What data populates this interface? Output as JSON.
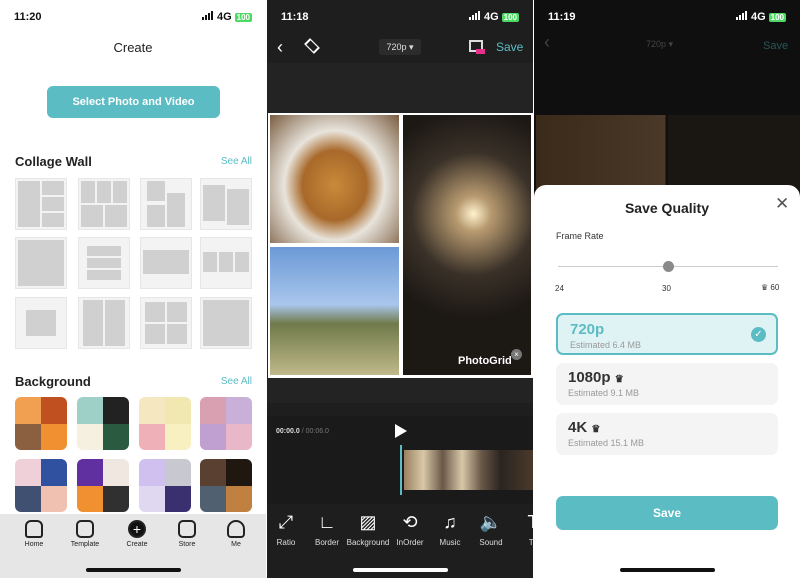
{
  "screen1": {
    "status": {
      "time": "11:20",
      "network": "4G",
      "battery": "100"
    },
    "title": "Create",
    "select_button": "Select Photo and Video",
    "collage": {
      "title": "Collage Wall",
      "see_all": "See All"
    },
    "background": {
      "title": "Background",
      "see_all": "See All"
    },
    "tabs": [
      {
        "label": "Home",
        "icon": "home-icon"
      },
      {
        "label": "Template",
        "icon": "template-icon"
      },
      {
        "label": "Create",
        "icon": "plus-icon"
      },
      {
        "label": "Store",
        "icon": "store-icon"
      },
      {
        "label": "Me",
        "icon": "person-icon"
      }
    ]
  },
  "screen2": {
    "status": {
      "time": "11:18",
      "network": "4G",
      "battery": "100"
    },
    "resolution": "720p",
    "save": "Save",
    "watermark": "PhotoGrid",
    "time_current": "00:00.0",
    "time_total": "/ 00:06.0",
    "tools": [
      {
        "label": "Ratio",
        "icon": "expand-icon"
      },
      {
        "label": "Border",
        "icon": "border-icon"
      },
      {
        "label": "Background",
        "icon": "stripes-icon"
      },
      {
        "label": "InOrder",
        "icon": "reorder-icon"
      },
      {
        "label": "Music",
        "icon": "music-icon"
      },
      {
        "label": "Sound",
        "icon": "speaker-icon"
      },
      {
        "label": "Te",
        "icon": "text-icon"
      }
    ]
  },
  "screen3": {
    "status": {
      "time": "11:19",
      "network": "4G",
      "battery": "100"
    },
    "sheet_title": "Save Quality",
    "frame_rate_label": "Frame Rate",
    "frame_rate": {
      "min": "24",
      "mid": "30",
      "max": "60",
      "selected": 30
    },
    "options": [
      {
        "res": "720p",
        "est": "Estimated 6.4 MB",
        "selected": true,
        "premium": false
      },
      {
        "res": "1080p",
        "est": "Estimated 9.1 MB",
        "selected": false,
        "premium": true
      },
      {
        "res": "4K",
        "est": "Estimated 15.1 MB",
        "selected": false,
        "premium": true
      }
    ],
    "save_button": "Save"
  },
  "colors": {
    "accent": "#5bbcc4",
    "dark_bg": "#1e1e1e"
  }
}
